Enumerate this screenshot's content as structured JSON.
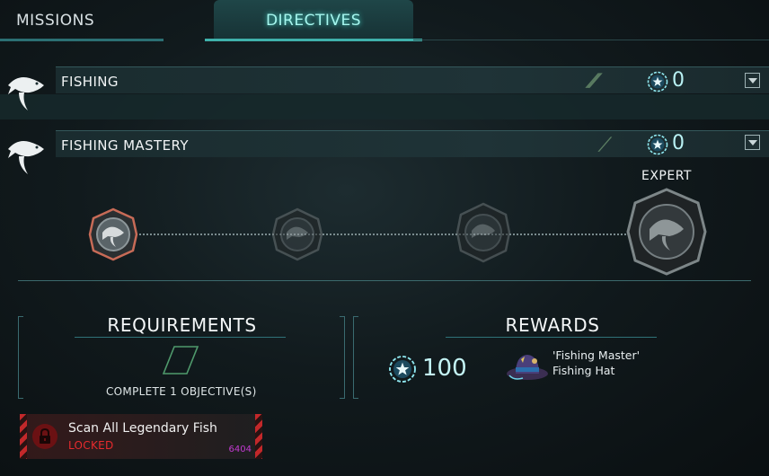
{
  "tabs": [
    {
      "label": "MISSIONS"
    },
    {
      "label": "DIRECTIVES"
    }
  ],
  "directives": [
    {
      "title": "FISHING",
      "points": "0",
      "icon": "fish-icon",
      "progress_icon": "double-slash"
    },
    {
      "title": "FISHING MASTERY",
      "points": "0",
      "icon": "fish-icon",
      "progress_icon": "single-slash"
    }
  ],
  "tiers": {
    "labels": [
      "EXPERT"
    ],
    "count": 4,
    "unlocked": 1
  },
  "requirements": {
    "title": "REQUIREMENTS",
    "text": "COMPLETE 1 OBJECTIVE(S)"
  },
  "rewards": {
    "title": "REWARDS",
    "points": "100",
    "item_name": "'Fishing Master' Fishing Hat",
    "item_icon": "fishing-hat-icon"
  },
  "objective": {
    "name": "Scan All Legendary Fish",
    "status": "LOCKED",
    "code": "6404"
  },
  "colors": {
    "accent": "#3fb1ab",
    "locked": "#e62a2d",
    "points": "#b9f2f4"
  }
}
